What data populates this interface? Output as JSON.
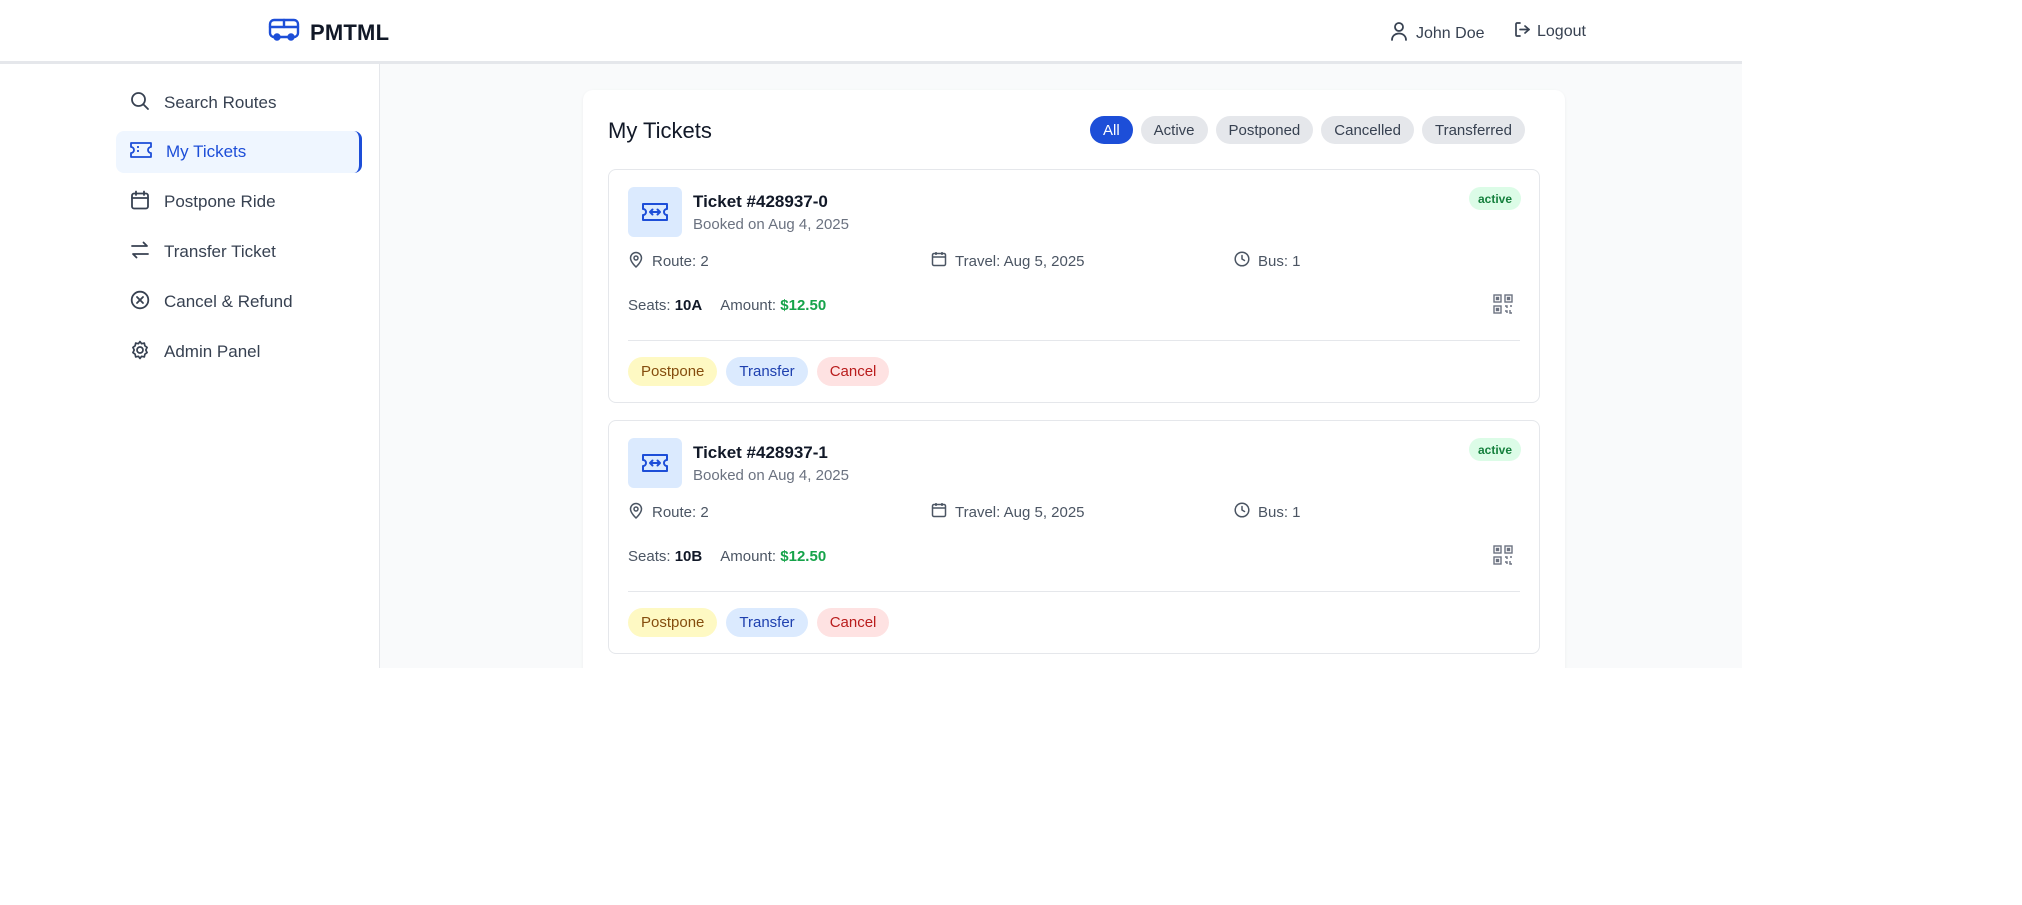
{
  "header": {
    "brand": "PMTML",
    "user_name": "John Doe",
    "logout_label": "Logout"
  },
  "sidebar": {
    "items": [
      {
        "label": "Search Routes",
        "icon": "search-icon"
      },
      {
        "label": "My Tickets",
        "icon": "ticket-icon",
        "active": true
      },
      {
        "label": "Postpone Ride",
        "icon": "calendar-icon"
      },
      {
        "label": "Transfer Ticket",
        "icon": "arrows-swap-icon"
      },
      {
        "label": "Cancel & Refund",
        "icon": "x-circle-icon"
      },
      {
        "label": "Admin Panel",
        "icon": "gear-icon"
      }
    ]
  },
  "main": {
    "title": "My Tickets",
    "filters": [
      {
        "label": "All",
        "active": true
      },
      {
        "label": "Active"
      },
      {
        "label": "Postponed"
      },
      {
        "label": "Cancelled"
      },
      {
        "label": "Transferred"
      }
    ],
    "tickets": [
      {
        "title": "Ticket #428937-0",
        "booked": "Booked on Aug 4, 2025",
        "status": "active",
        "route": "Route: 2",
        "travel": "Travel: Aug 5, 2025",
        "bus": "Bus: 1",
        "seats_label": "Seats:",
        "seats": "10A",
        "amount_label": "Amount:",
        "amount": "$12.50",
        "actions": {
          "postpone": "Postpone",
          "transfer": "Transfer",
          "cancel": "Cancel"
        }
      },
      {
        "title": "Ticket #428937-1",
        "booked": "Booked on Aug 4, 2025",
        "status": "active",
        "route": "Route: 2",
        "travel": "Travel: Aug 5, 2025",
        "bus": "Bus: 1",
        "seats_label": "Seats:",
        "seats": "10B",
        "amount_label": "Amount:",
        "amount": "$12.50",
        "actions": {
          "postpone": "Postpone",
          "transfer": "Transfer",
          "cancel": "Cancel"
        }
      }
    ]
  },
  "colors": {
    "accent": "#1d4ed8",
    "active_badge_bg": "#dcfce7",
    "amount": "#16a34a",
    "postpone_bg": "#fef9c3",
    "transfer_bg": "#dbeafe",
    "cancel_bg": "#fee2e2"
  }
}
